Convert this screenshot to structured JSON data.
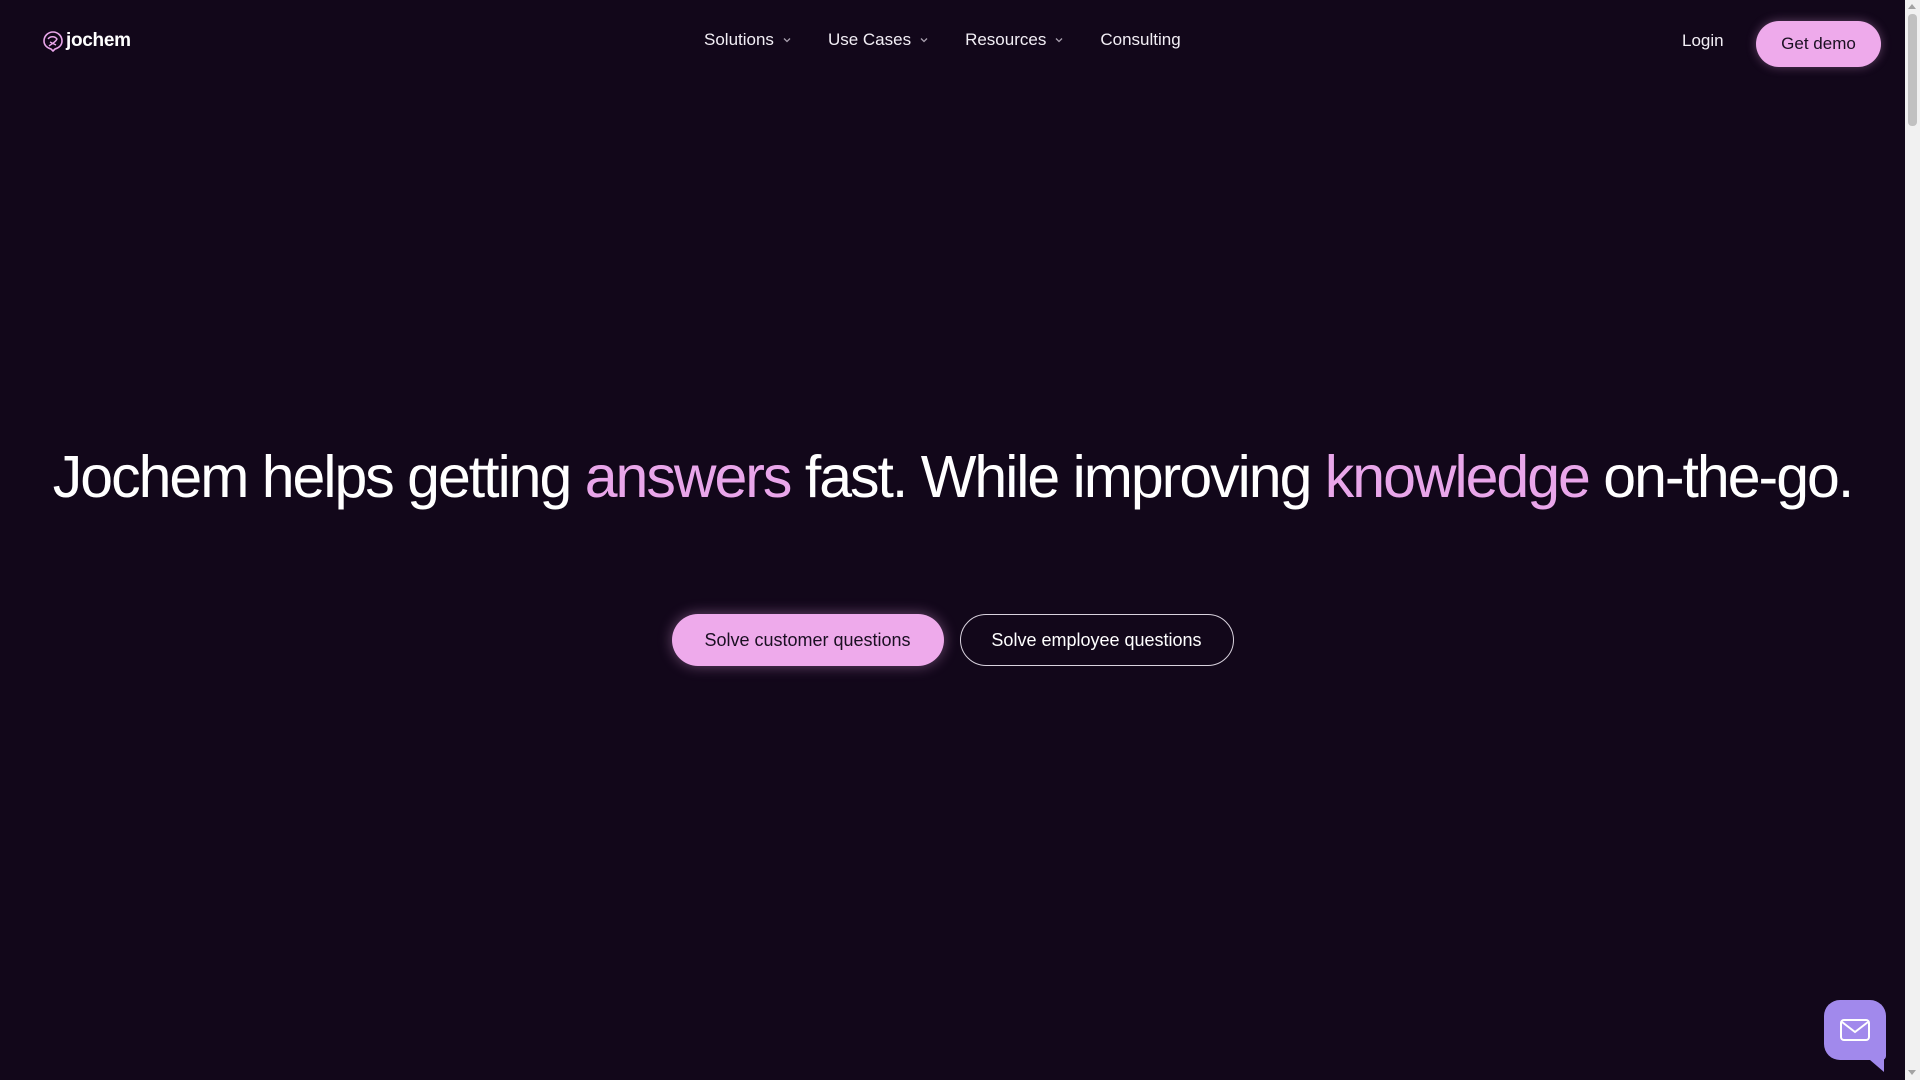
{
  "brand": {
    "name": "jochem",
    "accent_color": "#eeaaeb",
    "background_color": "#12071a"
  },
  "nav": {
    "items": [
      {
        "label": "Solutions",
        "has_dropdown": true
      },
      {
        "label": "Use Cases",
        "has_dropdown": true
      },
      {
        "label": "Resources",
        "has_dropdown": true
      },
      {
        "label": "Consulting",
        "has_dropdown": false
      }
    ],
    "login_label": "Login",
    "demo_label": "Get demo"
  },
  "hero": {
    "headline_parts": [
      {
        "text": "Jochem helps getting ",
        "accent": false
      },
      {
        "text": "answers",
        "accent": true
      },
      {
        "text": " fast. While improving ",
        "accent": false
      },
      {
        "text": "knowledge",
        "accent": true
      },
      {
        "text": " on-the-go.",
        "accent": false
      }
    ],
    "primary_cta": "Solve customer questions",
    "secondary_cta": "Solve employee questions"
  },
  "widgets": {
    "chat_icon": "mail-icon",
    "chat_color": "#a189ec"
  }
}
